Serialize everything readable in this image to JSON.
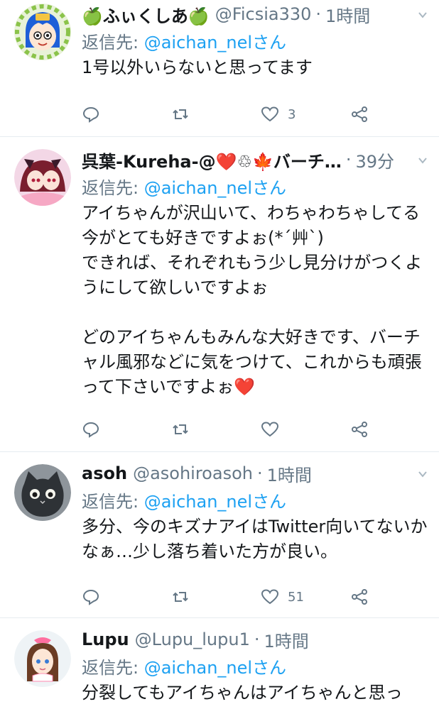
{
  "tweets": [
    {
      "name": "🍏ふぃくしあ🍏",
      "handle": "@Ficsia330",
      "sep": "·",
      "time": "1時間",
      "reply_prefix": "返信先: ",
      "reply_to": "@aichan_nelさん",
      "text": "1号以外いらないと思ってます",
      "reply_count": "",
      "retweet_count": "",
      "like_count": "3"
    },
    {
      "name": "呉葉-Kureha-@❤️♲🍁バーチ…",
      "handle": "",
      "sep": "·",
      "time": "39分",
      "reply_prefix": "返信先: ",
      "reply_to": "@aichan_nelさん",
      "text": "アイちゃんが沢山いて、わちゃわちゃしてる今がとても好きですよぉ(*´艸`)\nできれば、それぞれもう少し見分けがつくようにして欲しいですよぉ\n\nどのアイちゃんもみんな大好きです、バーチャル風邪などに気をつけて、これからも頑張って下さいですよぉ",
      "text_end_heart": "❤️",
      "reply_count": "",
      "retweet_count": "",
      "like_count": ""
    },
    {
      "name": "asoh",
      "handle": "@asohiroasoh",
      "sep": "·",
      "time": "1時間",
      "reply_prefix": "返信先: ",
      "reply_to": "@aichan_nelさん",
      "text": "多分、今のキズナアイはTwitter向いてないかなぁ…少し落ち着いた方が良い。",
      "reply_count": "",
      "retweet_count": "",
      "like_count": "51"
    },
    {
      "name": "Lupu",
      "handle": "@Lupu_lupu1",
      "sep": "·",
      "time": "1時間",
      "reply_prefix": "返信先: ",
      "reply_to": "@aichan_nelさん",
      "text": "分裂してもアイちゃんはアイちゃんと思っ"
    }
  ],
  "icons": {
    "reply": "reply-icon",
    "retweet": "retweet-icon",
    "like": "heart-icon",
    "share": "share-icon",
    "more": "chevron-down-icon"
  },
  "colors": {
    "link": "#1da1f2",
    "secondary": "#657786",
    "divider": "#e6ecf0",
    "heart": "#c2102a"
  }
}
